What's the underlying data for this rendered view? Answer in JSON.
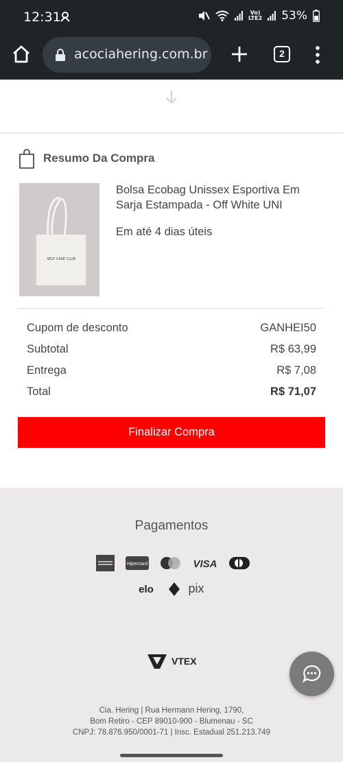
{
  "status_bar": {
    "time": "12:31",
    "battery": "53%",
    "network_top": "Vo)",
    "network_bottom": "LTE2"
  },
  "browser": {
    "url": "acociahering.com.br",
    "tab_count": "2"
  },
  "summary": {
    "title": "Resumo Da Compra"
  },
  "product": {
    "image_text": "SELF CARE CLUB",
    "name": "Bolsa Ecobag Unissex Esportiva Em Sarja Estampada - Off White UNI",
    "delivery": "Em até 4 dias úteis"
  },
  "totals": [
    {
      "label": "Cupom de desconto",
      "value": "GANHEI50"
    },
    {
      "label": "Subtotal",
      "value": "R$ 63,99"
    },
    {
      "label": "Entrega",
      "value": "R$ 7,08"
    },
    {
      "label": "Total",
      "value": "R$ 71,07"
    }
  ],
  "checkout_label": "Finalizar Compra",
  "footer": {
    "payments_title": "Pagamentos",
    "hipercard": "Hipercard",
    "visa": "VISA",
    "elo": "elo",
    "pix": "pix",
    "vtex": "VTEX",
    "address_line1": "Cia. Hering | Rua Hermann Hering, 1790,",
    "address_line2": "Bom Retiro - CEP 89010-900 - Blumenau - SC",
    "address_line3": "CNPJ: 78.876.950/0001-71 | Insc. Estadual 251.213.749"
  },
  "colors": {
    "accent": "#ff0000",
    "browser_chrome": "#1f2427",
    "footer_bg": "#ebe9e9"
  }
}
